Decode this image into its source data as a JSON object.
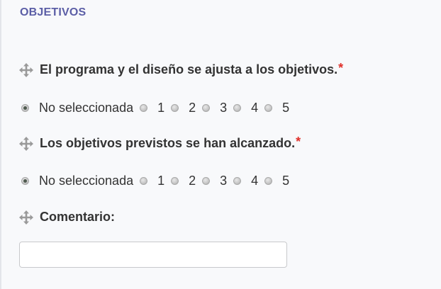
{
  "section": {
    "title": "OBJETIVOS"
  },
  "questions": [
    {
      "label": "El programa y el diseño se ajusta a los objetivos.",
      "required_mark": "*",
      "options": [
        "No seleccionada",
        "1",
        "2",
        "3",
        "4",
        "5"
      ],
      "selected": "No seleccionada"
    },
    {
      "label": "Los objetivos previstos se han alcanzado.",
      "required_mark": "*",
      "options": [
        "No seleccionada",
        "1",
        "2",
        "3",
        "4",
        "5"
      ],
      "selected": "No seleccionada"
    }
  ],
  "comment": {
    "label": "Comentario:",
    "value": ""
  },
  "colors": {
    "title": "#5b5ea6",
    "required": "#e0302a"
  },
  "icons": {
    "drag": "move-arrows-icon"
  }
}
